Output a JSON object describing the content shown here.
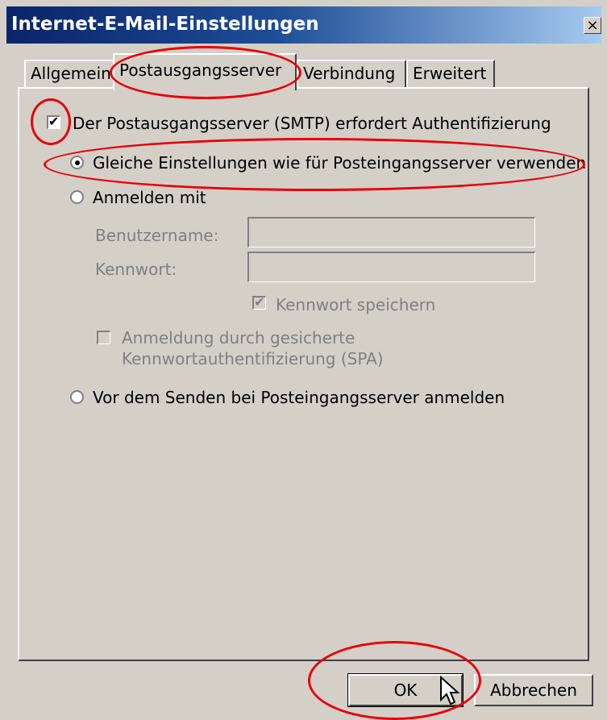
{
  "window": {
    "title": "Internet-E-Mail-Einstellungen",
    "close_glyph": "×"
  },
  "tabs": [
    {
      "label": "Allgemein"
    },
    {
      "label": "Postausgangsserver"
    },
    {
      "label": "Verbindung"
    },
    {
      "label": "Erweitert"
    }
  ],
  "smtp_auth": {
    "checked": true,
    "label": "Der Postausgangsserver (SMTP) erfordert Authentifizierung"
  },
  "options": {
    "same_settings": {
      "selected": true,
      "label": "Gleiche Einstellungen wie für Posteingangsserver verwenden"
    },
    "login_with": {
      "selected": false,
      "label": "Anmelden mit"
    },
    "login_before_send": {
      "selected": false,
      "label": "Vor dem Senden bei Posteingangsserver anmelden"
    }
  },
  "credentials": {
    "username_label": "Benutzername:",
    "username_value": "",
    "password_label": "Kennwort:",
    "password_value": "",
    "save_password": {
      "checked": true,
      "label": "Kennwort speichern"
    },
    "spa": {
      "checked": false,
      "label_line1": "Anmeldung durch gesicherte",
      "label_line2": "Kennwortauthentifizierung (SPA)"
    }
  },
  "buttons": {
    "ok": "OK",
    "cancel": "Abbrechen"
  },
  "colors": {
    "annotation": "#e8000b",
    "titlebar_start": "#0a246a",
    "titlebar_end": "#a6caf0",
    "dialog_bg": "#d4d0c8"
  }
}
